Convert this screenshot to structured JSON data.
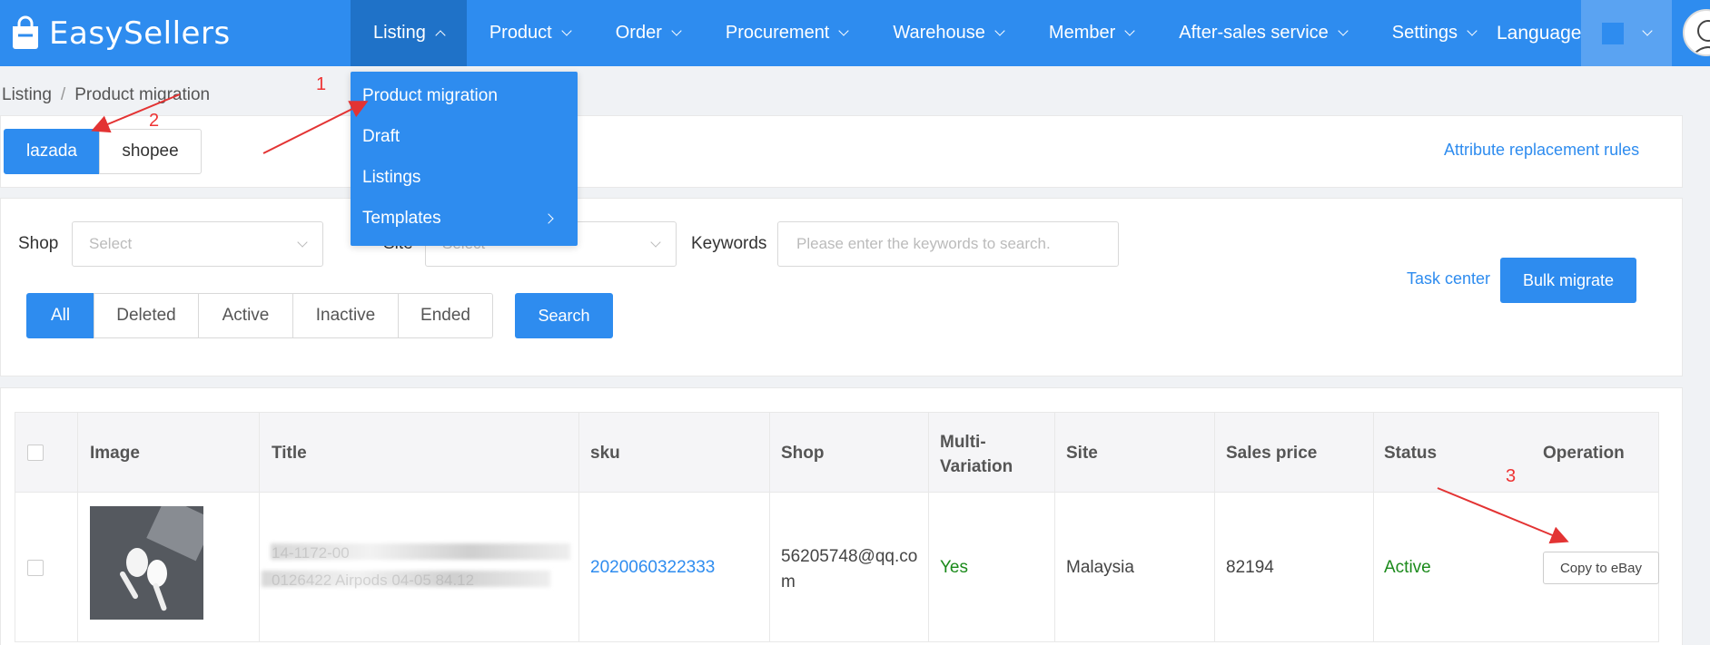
{
  "header": {
    "logo_text": "EasySellers",
    "nav": [
      {
        "label": "Listing",
        "active": true
      },
      {
        "label": "Product"
      },
      {
        "label": "Order"
      },
      {
        "label": "Procurement"
      },
      {
        "label": "Warehouse"
      },
      {
        "label": "Member"
      },
      {
        "label": "After-sales service"
      },
      {
        "label": "Settings"
      }
    ],
    "language_label": "Language"
  },
  "breadcrumb": {
    "root": "Listing",
    "separator": "/",
    "current": "Product migration"
  },
  "dropdown": {
    "items": [
      "Product migration",
      "Draft",
      "Listings",
      "Templates"
    ]
  },
  "platforms": {
    "lazada": "lazada",
    "shopee": "shopee"
  },
  "attribute_link": "Attribute replacement rules",
  "filters": {
    "shop_label": "Shop",
    "shop_placeholder": "Select",
    "site_label": "Site",
    "site_placeholder": "Select",
    "keywords_label": "Keywords",
    "keywords_placeholder": "Please enter the keywords to search.",
    "status_tabs": [
      "All",
      "Deleted",
      "Active",
      "Inactive",
      "Ended"
    ],
    "search_button": "Search",
    "task_center": "Task center",
    "bulk_migrate": "Bulk migrate"
  },
  "table": {
    "headers": {
      "image": "Image",
      "title": "Title",
      "sku": "sku",
      "shop": "Shop",
      "multi_variation": "Multi-\nVariation",
      "site": "Site",
      "sales_price": "Sales price",
      "status": "Status",
      "operation": "Operation"
    },
    "row": {
      "title_line1": "14-1172-00",
      "title_line2": "0126422 Airpods 04-05 84.12",
      "sku": "2020060322333",
      "shop": "56205748@qq.com",
      "multi_variation": "Yes",
      "site": "Malaysia",
      "sales_price": "82194",
      "status": "Active",
      "operation": "Copy to eBay"
    }
  },
  "annotations": [
    "1",
    "2",
    "3"
  ],
  "colors": {
    "primary": "#2e8cef",
    "success": "#1b8a1b",
    "annotation": "#e33333"
  }
}
